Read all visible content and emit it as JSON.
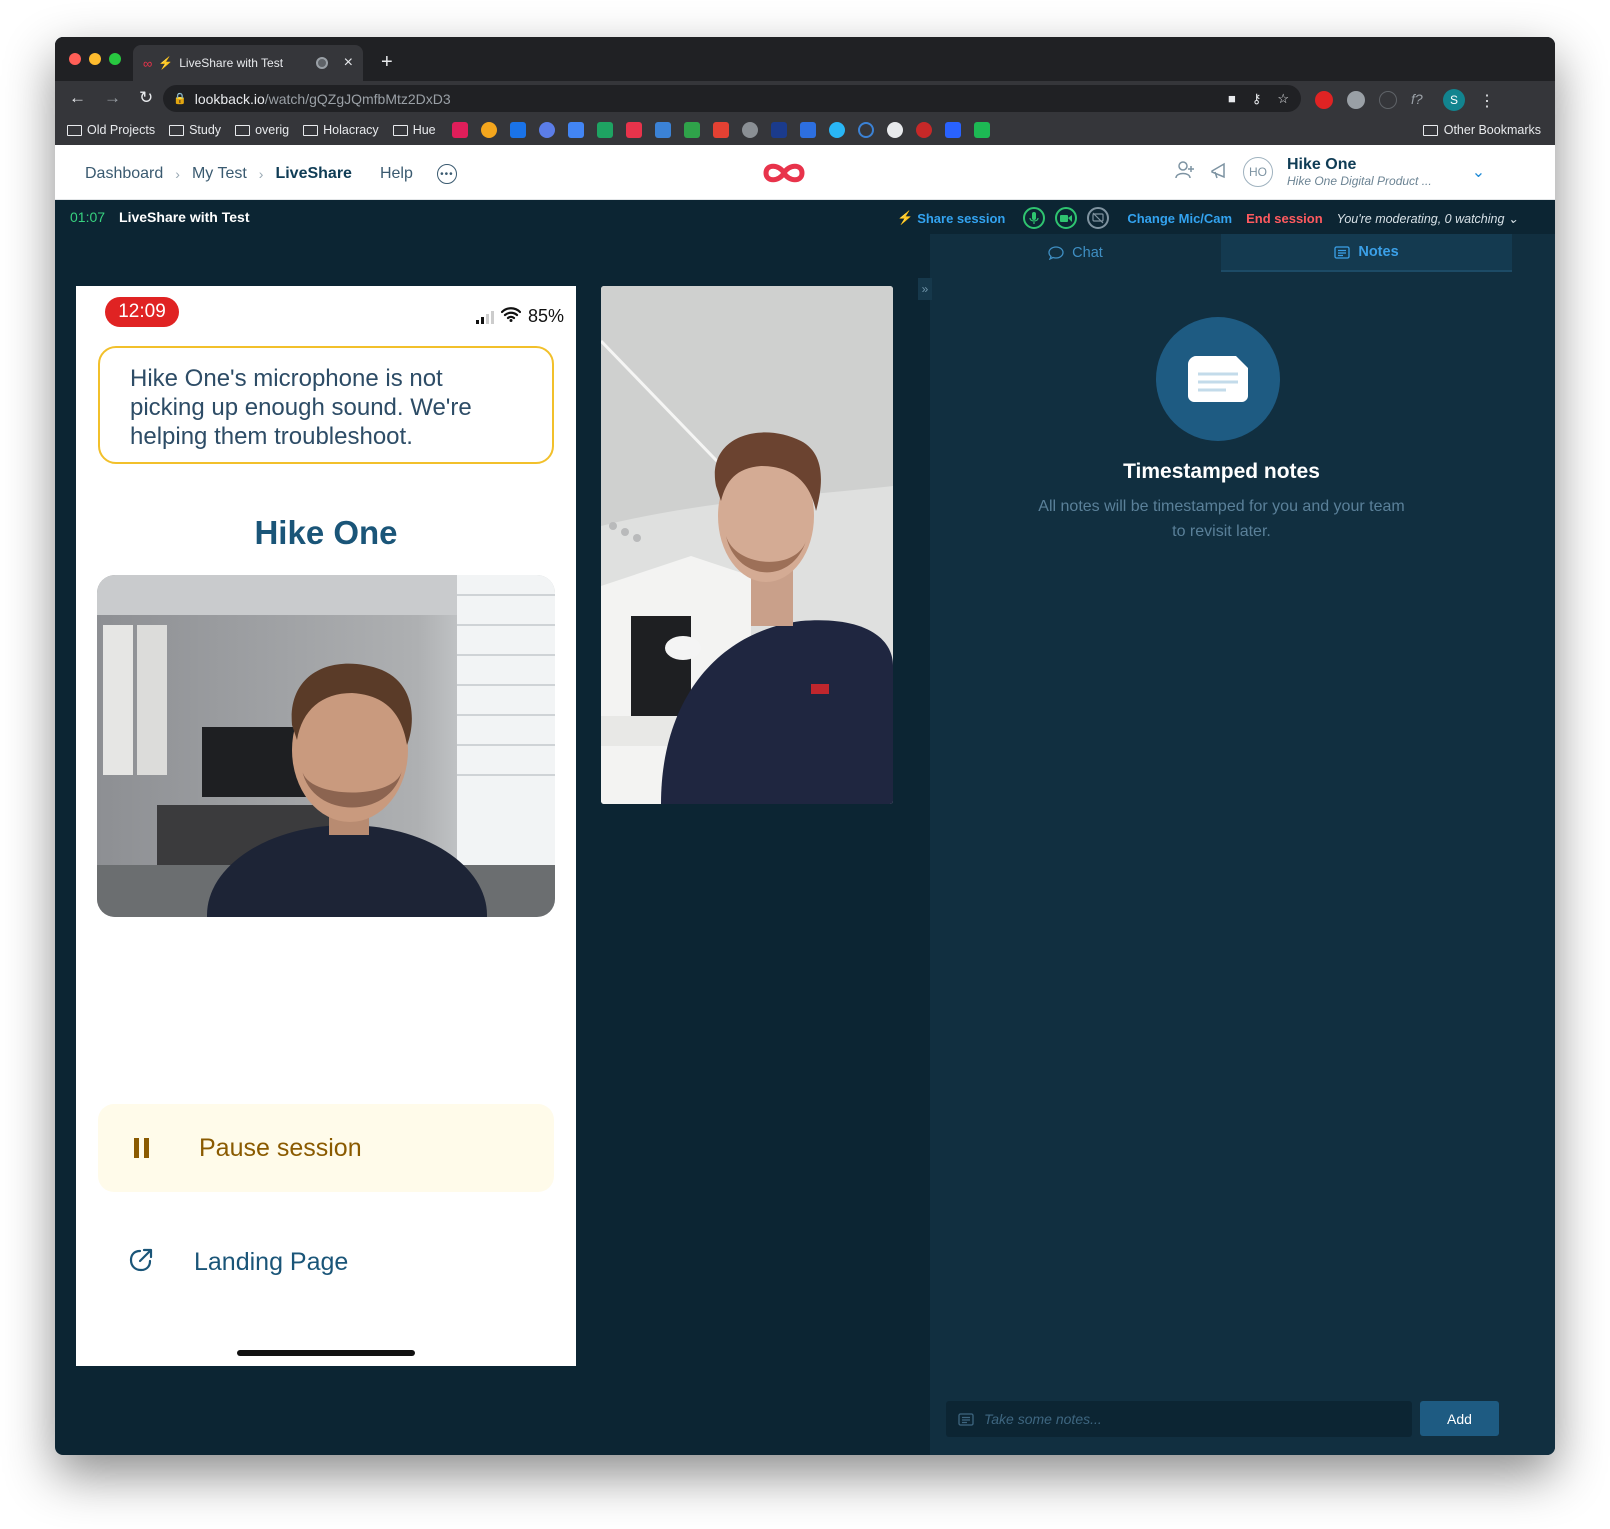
{
  "browser": {
    "tab_title": "LiveShare with Test",
    "url_host": "lookback.io",
    "url_path": "/watch/gQZgJQmfbMtz2DxD3",
    "bookmarks": [
      "Old Projects",
      "Study",
      "overig",
      "Holacracy",
      "Hue"
    ],
    "other_bookmarks": "Other Bookmarks",
    "profile_initial": "S"
  },
  "header": {
    "breadcrumbs": [
      "Dashboard",
      "My Test",
      "LiveShare"
    ],
    "help": "Help",
    "user_name": "Hike One",
    "user_org": "Hike One Digital Product ...",
    "avatar_initials": "HO"
  },
  "session": {
    "timer": "01:07",
    "title": "LiveShare with Test",
    "share_label": "Share session",
    "change_label": "Change Mic/Cam",
    "end_label": "End session",
    "moderating_text": "You're moderating, 0 watching"
  },
  "phone": {
    "clock": "12:09",
    "battery": "85%",
    "alert_text": "Hike One's microphone is not picking up enough sound. We're helping them troubleshoot.",
    "host_name": "Hike One",
    "pause_label": "Pause session",
    "landing_label": "Landing Page"
  },
  "panel": {
    "tabs": [
      {
        "label": "Chat",
        "active": false
      },
      {
        "label": "Notes",
        "active": true
      }
    ],
    "notes_title": "Timestamped notes",
    "notes_subtitle": "All notes will be timestamped for you and your team to revisit later.",
    "input_placeholder": "Take some notes...",
    "add_label": "Add"
  },
  "colors": {
    "brand_red": "#e8334b",
    "session_bg": "#0c2533",
    "panel_bg": "#112f40",
    "accent_blue": "#33a3f0",
    "alert_yellow": "#f2c02b",
    "live_green": "#37d27f"
  }
}
